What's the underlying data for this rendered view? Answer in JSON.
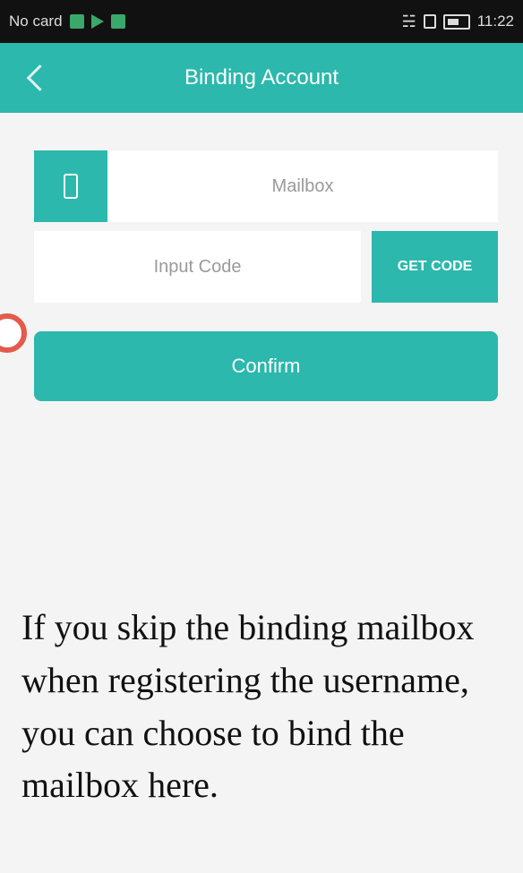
{
  "status_bar": {
    "carrier": "No card",
    "time": "11:22"
  },
  "appbar": {
    "title": "Binding Account"
  },
  "form": {
    "mailbox_placeholder": "Mailbox",
    "code_placeholder": "Input Code",
    "get_code_label": "GET CODE",
    "confirm_label": "Confirm"
  },
  "caption": {
    "text": "If you skip the binding mailbox when registering the username, you can choose to bind the mailbox here."
  },
  "icons": {
    "back": "chevron-left-icon",
    "phone": "phone-icon"
  },
  "colors": {
    "accent": "#2cb8ac",
    "status_bar_bg": "#111111",
    "page_bg": "#f4f4f4"
  }
}
